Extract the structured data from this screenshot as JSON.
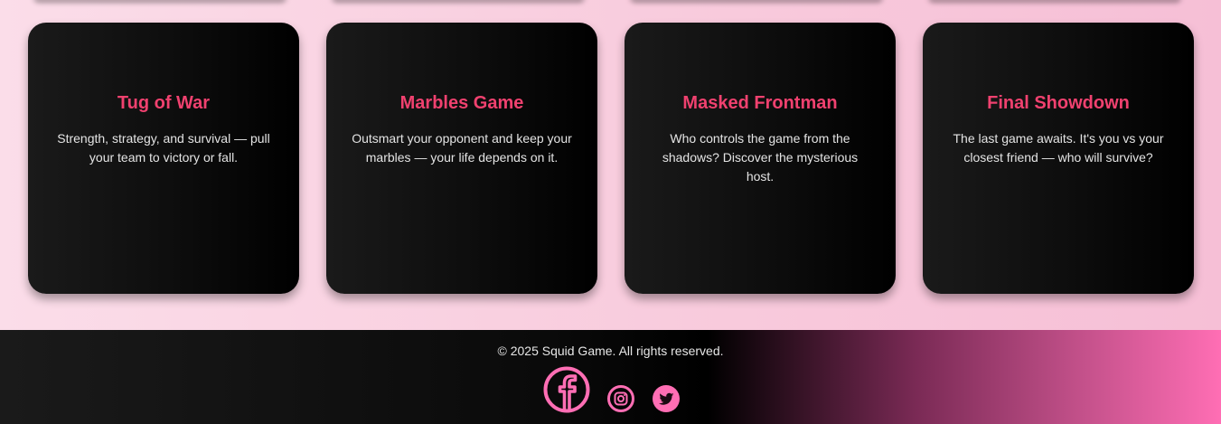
{
  "cards": [
    {
      "title": "Tug of War",
      "description": "Strength, strategy, and survival — pull your team to victory or fall."
    },
    {
      "title": "Marbles Game",
      "description": "Outsmart your opponent and keep your marbles — your life depends on it."
    },
    {
      "title": "Masked Frontman",
      "description": "Who controls the game from the shadows? Discover the mysterious host."
    },
    {
      "title": "Final Showdown",
      "description": "The last game awaits. It's you vs your closest friend — who will survive?"
    }
  ],
  "footer": {
    "copyright": "© 2025 Squid Game. All rights reserved.",
    "social_icons": [
      "facebook-icon",
      "instagram-icon",
      "twitter-icon"
    ]
  },
  "colors": {
    "accent_pink": "#f0416f",
    "icon_pink": "#ff6eb4",
    "card_bg": "#0d0d0d",
    "page_bg": "#f8cadc"
  }
}
